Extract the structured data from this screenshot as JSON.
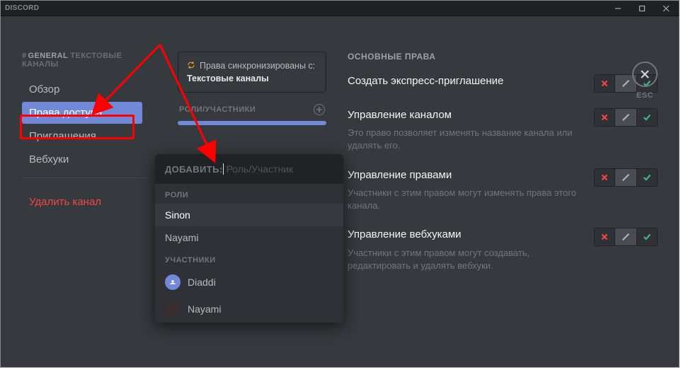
{
  "titlebar": {
    "app_name": "DISCORD"
  },
  "sidebar": {
    "hash": "#",
    "channel_name": "GENERAL",
    "category_label": "ТЕКСТОВЫЕ КАНАЛЫ",
    "items": [
      {
        "label": "Обзор"
      },
      {
        "label": "Права доступа"
      },
      {
        "label": "Приглашения"
      },
      {
        "label": "Вебхуки"
      }
    ],
    "delete_label": "Удалить канал"
  },
  "midcol": {
    "sync_prefix": "Права синхронизированы с: ",
    "sync_target": "Текстовые каналы",
    "roles_header": "РОЛИ/УЧАСТНИКИ"
  },
  "popup": {
    "add_label": "ДОБАВИТЬ:",
    "placeholder": "Роль/Участник",
    "section_roles": "РОЛИ",
    "section_members": "УЧАСТНИКИ",
    "roles": [
      {
        "label": "Sinon"
      },
      {
        "label": "Nayami"
      }
    ],
    "members": [
      {
        "label": "Diaddi"
      },
      {
        "label": "Nayami"
      }
    ]
  },
  "permissions": {
    "header": "ОСНОВНЫЕ ПРАВА",
    "rows": [
      {
        "name": "Создать экспресс-приглашение",
        "desc": ""
      },
      {
        "name": "Управление каналом",
        "desc": "Это право позволяет изменять название канала или удалять его."
      },
      {
        "name": "Управление правами",
        "desc": "Участники с этим правом могут изменять права этого канала."
      },
      {
        "name": "Управление вебхуками",
        "desc": "Участники с этим правом могут создавать, редактировать и удалять вебхуки."
      }
    ]
  },
  "close": {
    "esc": "ESC"
  }
}
